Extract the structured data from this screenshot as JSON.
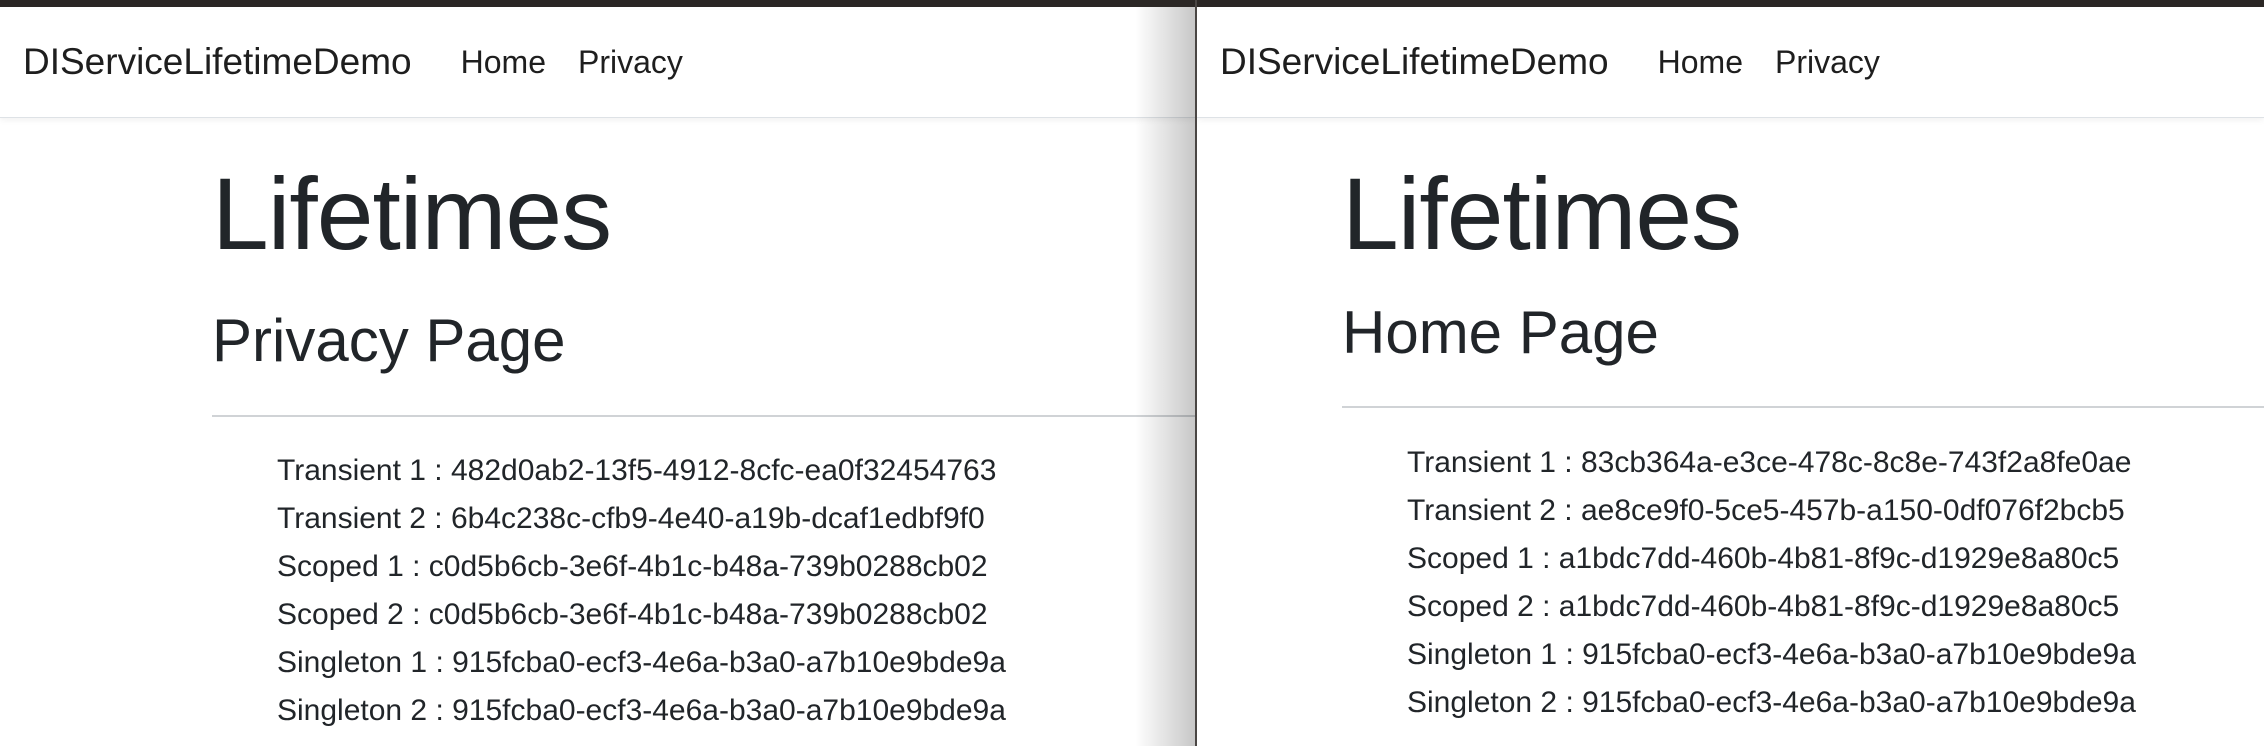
{
  "windows": [
    {
      "brand": "DIServiceLifetimeDemo",
      "nav": {
        "home": "Home",
        "privacy": "Privacy"
      },
      "title": "Lifetimes",
      "page_heading": "Privacy Page",
      "lifetimes": [
        "Transient 1 : 482d0ab2-13f5-4912-8cfc-ea0f32454763",
        "Transient 2 : 6b4c238c-cfb9-4e40-a19b-dcaf1edbf9f0",
        "Scoped 1 : c0d5b6cb-3e6f-4b1c-b48a-739b0288cb02",
        "Scoped 2 : c0d5b6cb-3e6f-4b1c-b48a-739b0288cb02",
        "Singleton 1 : 915fcba0-ecf3-4e6a-b3a0-a7b10e9bde9a",
        "Singleton 2 : 915fcba0-ecf3-4e6a-b3a0-a7b10e9bde9a"
      ]
    },
    {
      "brand": "DIServiceLifetimeDemo",
      "nav": {
        "home": "Home",
        "privacy": "Privacy"
      },
      "title": "Lifetimes",
      "page_heading": "Home Page",
      "lifetimes": [
        "Transient 1 : 83cb364a-e3ce-478c-8c8e-743f2a8fe0ae",
        "Transient 2 : ae8ce9f0-5ce5-457b-a150-0df076f2bcb5",
        "Scoped 1 : a1bdc7dd-460b-4b81-8f9c-d1929e8a80c5",
        "Scoped 2 : a1bdc7dd-460b-4b81-8f9c-d1929e8a80c5",
        "Singleton 1 : 915fcba0-ecf3-4e6a-b3a0-a7b10e9bde9a",
        "Singleton 2 : 915fcba0-ecf3-4e6a-b3a0-a7b10e9bde9a"
      ]
    }
  ]
}
